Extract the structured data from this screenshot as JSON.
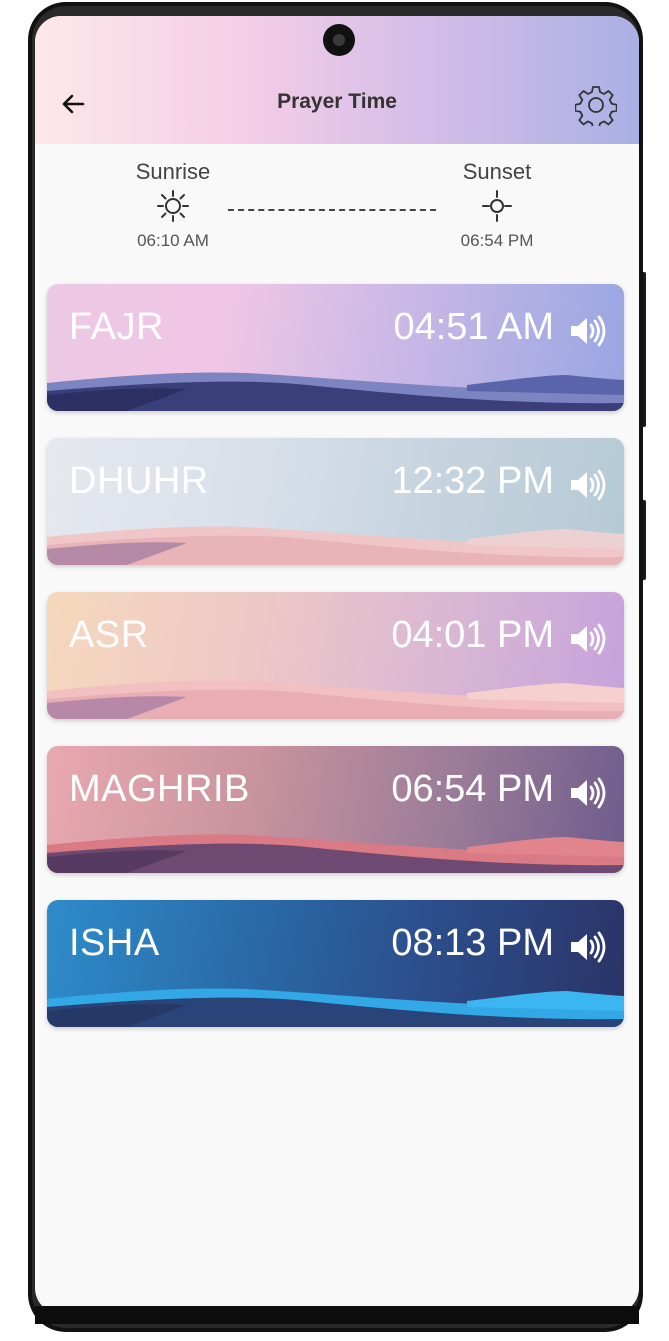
{
  "header": {
    "title": "Prayer Time"
  },
  "sun": {
    "sunrise_label": "Sunrise",
    "sunrise_time": "06:10 AM",
    "sunset_label": "Sunset",
    "sunset_time": "06:54 PM"
  },
  "prayers": [
    {
      "name": "FAJR",
      "time": "04:51 AM",
      "icon": "speaker-icon"
    },
    {
      "name": "DHUHR",
      "time": "12:32 PM",
      "icon": "speaker-icon"
    },
    {
      "name": "ASR",
      "time": "04:01 PM",
      "icon": "speaker-icon"
    },
    {
      "name": "MAGHRIB",
      "time": "06:54 PM",
      "icon": "speaker-icon"
    },
    {
      "name": "ISHA",
      "time": "08:13 PM",
      "icon": "speaker-icon"
    }
  ],
  "icons": {
    "back": "back-arrow-icon",
    "settings": "gear-icon",
    "sunrise": "sunrise-icon",
    "sunset": "sunset-icon"
  },
  "colors": {
    "fajr": [
      "#f2c6e4",
      "#9aa6e2"
    ],
    "dhuhr": [
      "#e4e6ee",
      "#b8cdd8"
    ],
    "asr": [
      "#f5d4b8",
      "#c9a5dc"
    ],
    "maghrib": [
      "#e8a5ae",
      "#6e5c8c"
    ],
    "isha": [
      "#2d86c4",
      "#2b3468"
    ]
  }
}
